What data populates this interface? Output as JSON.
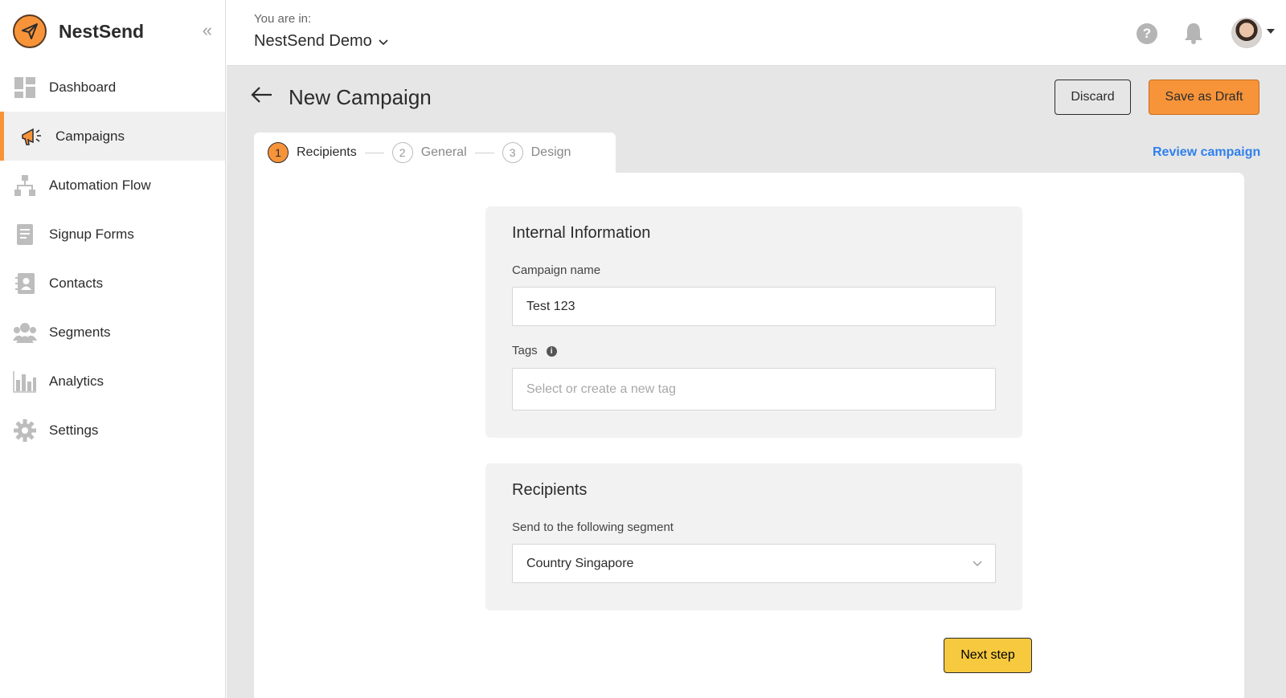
{
  "brand": {
    "name": "NestSend",
    "collapse_icon": "double-chevron-left-icon"
  },
  "sidebar": {
    "items": [
      {
        "label": "Dashboard",
        "icon": "dashboard-icon",
        "active": false
      },
      {
        "label": "Campaigns",
        "icon": "megaphone-icon",
        "active": true
      },
      {
        "label": "Automation Flow",
        "icon": "hierarchy-icon",
        "active": false
      },
      {
        "label": "Signup Forms",
        "icon": "form-document-icon",
        "active": false
      },
      {
        "label": "Contacts",
        "icon": "contact-card-icon",
        "active": false
      },
      {
        "label": "Segments",
        "icon": "users-group-icon",
        "active": false
      },
      {
        "label": "Analytics",
        "icon": "bar-chart-icon",
        "active": false
      },
      {
        "label": "Settings",
        "icon": "gear-icon",
        "active": false
      }
    ]
  },
  "header": {
    "you_are_in": "You are in:",
    "workspace": "NestSend Demo",
    "help": "?"
  },
  "page": {
    "title": "New Campaign",
    "discard_label": "Discard",
    "save_draft_label": "Save as Draft",
    "review_label": "Review campaign",
    "next_label": "Next step"
  },
  "steps": [
    {
      "num": "1",
      "label": "Recipients",
      "active": true
    },
    {
      "num": "2",
      "label": "General",
      "active": false
    },
    {
      "num": "3",
      "label": "Design",
      "active": false
    }
  ],
  "internal_info": {
    "title": "Internal Information",
    "campaign_name_label": "Campaign name",
    "campaign_name_value": "Test 123",
    "tags_label": "Tags",
    "tags_info": "i",
    "tags_placeholder": "Select or create a new tag"
  },
  "recipients": {
    "title": "Recipients",
    "segment_label": "Send to the following segment",
    "segment_value": "Country Singapore"
  },
  "colors": {
    "accent": "#f7943a",
    "next_button": "#f7c93f",
    "link": "#2f80ed",
    "background": "#e6e6e6"
  }
}
